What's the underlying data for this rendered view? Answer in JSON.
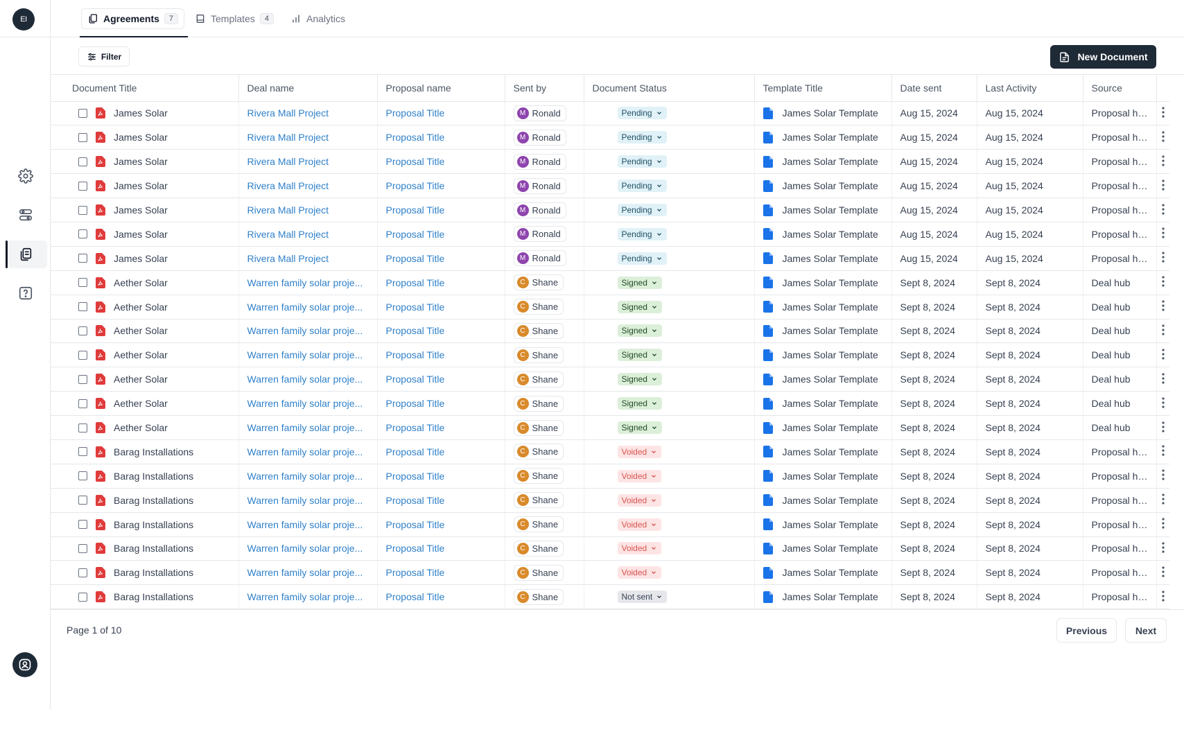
{
  "logo": {
    "text": "EI"
  },
  "tabs": [
    {
      "label": "Agreements",
      "count": "7",
      "icon": "documents-icon"
    },
    {
      "label": "Templates",
      "count": "4",
      "icon": "book-icon"
    },
    {
      "label": "Analytics",
      "icon": "bar-chart-icon"
    }
  ],
  "sidebar": {
    "icons": [
      "gear-icon",
      "sliders-icon",
      "documents-icon",
      "help-icon"
    ],
    "bottom": "user-circle-icon"
  },
  "toolbar": {
    "filter_label": "Filter",
    "new_document_label": "New Document"
  },
  "table": {
    "headers": [
      "Document Title",
      "Deal name",
      "Proposal name",
      "Sent by",
      "Document Status",
      "Template Title",
      "Date sent",
      "Last Activity",
      "Source"
    ],
    "rows": [
      {
        "title": "James Solar",
        "deal": "Rivera Mall Project",
        "proposal": "Proposal Title",
        "sender_initial": "M",
        "sender": "Ronald",
        "status": "Pending",
        "template": "James Solar Template",
        "date_sent": "Aug 15, 2024",
        "last_activity": "Aug 15, 2024",
        "source": "Proposal hub"
      },
      {
        "title": "James Solar",
        "deal": "Rivera Mall Project",
        "proposal": "Proposal Title",
        "sender_initial": "M",
        "sender": "Ronald",
        "status": "Pending",
        "template": "James Solar Template",
        "date_sent": "Aug 15, 2024",
        "last_activity": "Aug 15, 2024",
        "source": "Proposal hub"
      },
      {
        "title": "James Solar",
        "deal": "Rivera Mall Project",
        "proposal": "Proposal Title",
        "sender_initial": "M",
        "sender": "Ronald",
        "status": "Pending",
        "template": "James Solar Template",
        "date_sent": "Aug 15, 2024",
        "last_activity": "Aug 15, 2024",
        "source": "Proposal hub"
      },
      {
        "title": "James Solar",
        "deal": "Rivera Mall Project",
        "proposal": "Proposal Title",
        "sender_initial": "M",
        "sender": "Ronald",
        "status": "Pending",
        "template": "James Solar Template",
        "date_sent": "Aug 15, 2024",
        "last_activity": "Aug 15, 2024",
        "source": "Proposal hub"
      },
      {
        "title": "James Solar",
        "deal": "Rivera Mall Project",
        "proposal": "Proposal Title",
        "sender_initial": "M",
        "sender": "Ronald",
        "status": "Pending",
        "template": "James Solar Template",
        "date_sent": "Aug 15, 2024",
        "last_activity": "Aug 15, 2024",
        "source": "Proposal hub"
      },
      {
        "title": "James Solar",
        "deal": "Rivera Mall Project",
        "proposal": "Proposal Title",
        "sender_initial": "M",
        "sender": "Ronald",
        "status": "Pending",
        "template": "James Solar Template",
        "date_sent": "Aug 15, 2024",
        "last_activity": "Aug 15, 2024",
        "source": "Proposal hub"
      },
      {
        "title": "James Solar",
        "deal": "Rivera Mall Project",
        "proposal": "Proposal Title",
        "sender_initial": "M",
        "sender": "Ronald",
        "status": "Pending",
        "template": "James Solar Template",
        "date_sent": "Aug 15, 2024",
        "last_activity": "Aug 15, 2024",
        "source": "Proposal hub"
      },
      {
        "title": "Aether Solar",
        "deal": "Warren family solar proje...",
        "proposal": "Proposal Title",
        "sender_initial": "C",
        "sender": "Shane",
        "status": "Signed",
        "template": "James Solar Template",
        "date_sent": "Sept 8, 2024",
        "last_activity": "Sept 8, 2024",
        "source": "Deal hub"
      },
      {
        "title": "Aether Solar",
        "deal": "Warren family solar proje...",
        "proposal": "Proposal Title",
        "sender_initial": "C",
        "sender": "Shane",
        "status": "Signed",
        "template": "James Solar Template",
        "date_sent": "Sept 8, 2024",
        "last_activity": "Sept 8, 2024",
        "source": "Deal hub"
      },
      {
        "title": "Aether Solar",
        "deal": "Warren family solar proje...",
        "proposal": "Proposal Title",
        "sender_initial": "C",
        "sender": "Shane",
        "status": "Signed",
        "template": "James Solar Template",
        "date_sent": "Sept 8, 2024",
        "last_activity": "Sept 8, 2024",
        "source": "Deal hub"
      },
      {
        "title": "Aether Solar",
        "deal": "Warren family solar proje...",
        "proposal": "Proposal Title",
        "sender_initial": "C",
        "sender": "Shane",
        "status": "Signed",
        "template": "James Solar Template",
        "date_sent": "Sept 8, 2024",
        "last_activity": "Sept 8, 2024",
        "source": "Deal hub"
      },
      {
        "title": "Aether Solar",
        "deal": "Warren family solar proje...",
        "proposal": "Proposal Title",
        "sender_initial": "C",
        "sender": "Shane",
        "status": "Signed",
        "template": "James Solar Template",
        "date_sent": "Sept 8, 2024",
        "last_activity": "Sept 8, 2024",
        "source": "Deal hub"
      },
      {
        "title": "Aether Solar",
        "deal": "Warren family solar proje...",
        "proposal": "Proposal Title",
        "sender_initial": "C",
        "sender": "Shane",
        "status": "Signed",
        "template": "James Solar Template",
        "date_sent": "Sept 8, 2024",
        "last_activity": "Sept 8, 2024",
        "source": "Deal hub"
      },
      {
        "title": "Aether Solar",
        "deal": "Warren family solar proje...",
        "proposal": "Proposal Title",
        "sender_initial": "C",
        "sender": "Shane",
        "status": "Signed",
        "template": "James Solar Template",
        "date_sent": "Sept 8, 2024",
        "last_activity": "Sept 8, 2024",
        "source": "Deal hub"
      },
      {
        "title": "Barag Installations",
        "deal": "Warren family solar proje...",
        "proposal": "Proposal Title",
        "sender_initial": "C",
        "sender": "Shane",
        "status": "Voided",
        "template": "James Solar Template",
        "date_sent": "Sept 8, 2024",
        "last_activity": "Sept 8, 2024",
        "source": "Proposal hub"
      },
      {
        "title": "Barag Installations",
        "deal": "Warren family solar proje...",
        "proposal": "Proposal Title",
        "sender_initial": "C",
        "sender": "Shane",
        "status": "Voided",
        "template": "James Solar Template",
        "date_sent": "Sept 8, 2024",
        "last_activity": "Sept 8, 2024",
        "source": "Proposal hub"
      },
      {
        "title": "Barag Installations",
        "deal": "Warren family solar proje...",
        "proposal": "Proposal Title",
        "sender_initial": "C",
        "sender": "Shane",
        "status": "Voided",
        "template": "James Solar Template",
        "date_sent": "Sept 8, 2024",
        "last_activity": "Sept 8, 2024",
        "source": "Proposal hub"
      },
      {
        "title": "Barag Installations",
        "deal": "Warren family solar proje...",
        "proposal": "Proposal Title",
        "sender_initial": "C",
        "sender": "Shane",
        "status": "Voided",
        "template": "James Solar Template",
        "date_sent": "Sept 8, 2024",
        "last_activity": "Sept 8, 2024",
        "source": "Proposal hub"
      },
      {
        "title": "Barag Installations",
        "deal": "Warren family solar proje...",
        "proposal": "Proposal Title",
        "sender_initial": "C",
        "sender": "Shane",
        "status": "Voided",
        "template": "James Solar Template",
        "date_sent": "Sept 8, 2024",
        "last_activity": "Sept 8, 2024",
        "source": "Proposal hub"
      },
      {
        "title": "Barag Installations",
        "deal": "Warren family solar proje...",
        "proposal": "Proposal Title",
        "sender_initial": "C",
        "sender": "Shane",
        "status": "Voided",
        "template": "James Solar Template",
        "date_sent": "Sept 8, 2024",
        "last_activity": "Sept 8, 2024",
        "source": "Proposal hub"
      },
      {
        "title": "Barag Installations",
        "deal": "Warren family solar proje...",
        "proposal": "Proposal Title",
        "sender_initial": "C",
        "sender": "Shane",
        "status": "Not sent",
        "template": "James Solar Template",
        "date_sent": "Sept 8, 2024",
        "last_activity": "Sept 8, 2024",
        "source": "Proposal hub"
      }
    ]
  },
  "status_colors": {
    "Pending": {
      "bg": "#e0f1f7",
      "fg": "#1f4f63"
    },
    "Signed": {
      "bg": "#dcefd9",
      "fg": "#1f4a25"
    },
    "Voided": {
      "bg": "#fde4e4",
      "fg": "#d9534f"
    },
    "Not sent": {
      "bg": "#e5e7eb",
      "fg": "#374151"
    }
  },
  "sender_colors": {
    "M": "#8e44ad",
    "C": "#d98a2b"
  },
  "colors": {
    "link": "#2f80c9",
    "primary_button": "#1f2a37",
    "pdf_icon": "#e03b3b",
    "template_icon": "#1a73e8"
  },
  "pagination": {
    "page_info": "Page 1 of 10",
    "previous_label": "Previous",
    "next_label": "Next"
  }
}
